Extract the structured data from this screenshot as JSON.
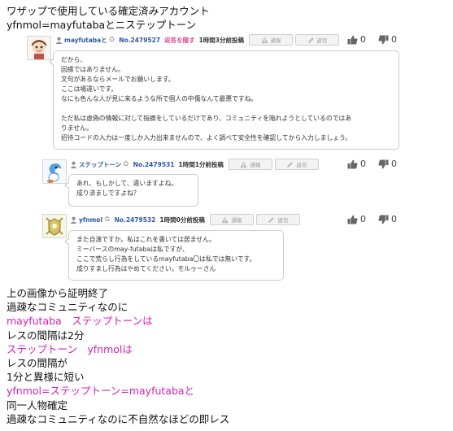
{
  "intro": [
    "ワザップで使用している確定済みアカウント",
    "yfnmol=mayfutabaとニステップトーン"
  ],
  "comments": [
    {
      "username": "mayfutabaと",
      "number": "No.2479527",
      "hide_label": "返答を隠す",
      "time": "1時間3分前投稿",
      "report_label": "通報",
      "reply_label": "返信",
      "good": "0",
      "bad": "0",
      "lines": [
        "だから、",
        "因縁ではありません。",
        "文句があるならメールでお願いします。",
        "ここは場違いです。",
        "なにも色んな人が見に来るような所で個人の中傷なんて最悪ですね。",
        "",
        "ただ私は虚偽の情報に対して指摘をしているだけであり、コミュニティを陥れようとしているのではあ",
        "りません。",
        "招待コードの入力は一度しか入力出来ませんので、よく調べて安全性を確認してから入力しましょう。"
      ]
    },
    {
      "username": "ステップトーン",
      "number": "No.2479531",
      "time": "1時間1分前投稿",
      "report_label": "通報",
      "reply_label": "返信",
      "good": "0",
      "bad": "0",
      "lines": [
        "あれ、もしかして、違いますよね。",
        "成り済ましですよね？"
      ]
    },
    {
      "username": "yfnmol",
      "number": "No.2479532",
      "time": "1時間0分前投稿",
      "report_label": "通報",
      "reply_label": "返信",
      "good": "0",
      "bad": "0",
      "lines": [
        "また自演ですか。私はこれを書いては居ません。",
        "ミーバースのmay-futabaは私ですが、",
        "ここで荒らし行為をしているmayfutaba〇は私では無いです。",
        "成りすまし行為はやめてください。モルゥーさん"
      ]
    }
  ],
  "conclusion": [
    {
      "text": "上の画像から証明終了",
      "color": "#111111"
    },
    {
      "text": "過疎なコミュニティなのに",
      "color": "#111111"
    },
    {
      "text": "mayfutaba　ステップトーンは",
      "color": "#d81eb8"
    },
    {
      "text": "レスの間隔は2分",
      "color": "#111111"
    },
    {
      "text": "ステップトーン　yfnmolは",
      "color": "#d81eb8"
    },
    {
      "text": "レスの間隔が",
      "color": "#111111"
    },
    {
      "text": "1分と異様に短い",
      "color": "#111111"
    },
    {
      "text": "yfnmol=ステップトーン=mayfutabaと",
      "color": "#d81eb8"
    },
    {
      "text": "同一人物確定",
      "color": "#111111"
    },
    {
      "text": "過疎なコミュニティなのに不自然なほどの即レス",
      "color": "#111111"
    }
  ],
  "colors": {
    "link": "#2c5aa0",
    "accent": "#d81eb8",
    "hide": "#e0508a",
    "border": "#cccccc"
  },
  "icons": [
    "user-icon",
    "star-icon",
    "warning-icon",
    "pencil-icon",
    "thumbs-up-icon",
    "thumbs-down-icon"
  ]
}
